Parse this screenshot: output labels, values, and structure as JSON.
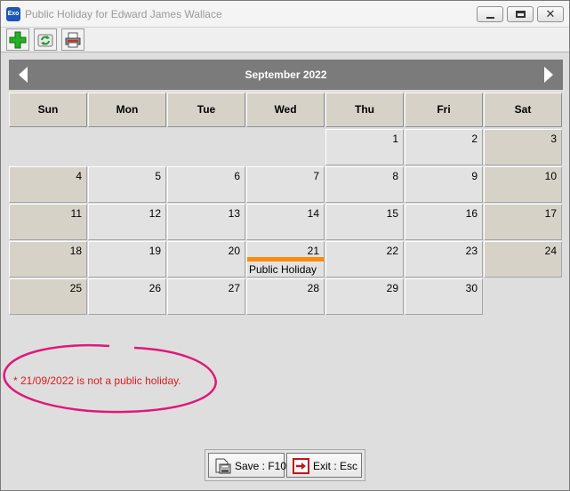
{
  "window": {
    "title": "Public Holiday for Edward James Wallace",
    "app_icon_text": "Exo"
  },
  "toolbar": {
    "add_icon": "plus-icon",
    "refresh_icon": "refresh-icon",
    "print_icon": "printer-icon"
  },
  "calendar": {
    "month_title": "September 2022",
    "days_of_week": [
      "Sun",
      "Mon",
      "Tue",
      "Wed",
      "Thu",
      "Fri",
      "Sat"
    ],
    "weeks": [
      [
        "",
        "",
        "",
        "",
        "1",
        "2",
        "3"
      ],
      [
        "4",
        "5",
        "6",
        "7",
        "8",
        "9",
        "10"
      ],
      [
        "11",
        "12",
        "13",
        "14",
        "15",
        "16",
        "17"
      ],
      [
        "18",
        "19",
        "20",
        "21",
        "22",
        "23",
        "24"
      ],
      [
        "25",
        "26",
        "27",
        "28",
        "29",
        "30",
        ""
      ]
    ],
    "holiday": {
      "date": "21",
      "label": "Public Holiday",
      "color": "#f98b0e"
    },
    "colors": {
      "header_bg": "#7b7b7b",
      "weekend_bg": "#d7d2c8",
      "weekday_bg": "#e2e2e2"
    }
  },
  "warning": {
    "text": "* 21/09/2022 is not a public holiday.",
    "color": "#d91d1d",
    "annotation_color": "#e0187a"
  },
  "buttons": {
    "save_label": "Save : F10",
    "exit_label": "Exit : Esc"
  }
}
